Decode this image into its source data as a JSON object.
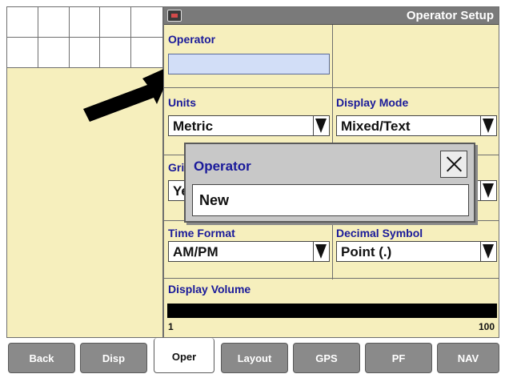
{
  "window": {
    "title": "Operator Setup",
    "icon": "screen-icon"
  },
  "operator": {
    "label": "Operator",
    "value": ""
  },
  "units": {
    "label": "Units",
    "value": "Metric"
  },
  "display_mode": {
    "label": "Display Mode",
    "value": "Mixed/Text"
  },
  "grid_section": {
    "label_fragment": "Gri",
    "value_fragment": "Ye"
  },
  "time_format": {
    "label": "Time Format",
    "value": "AM/PM"
  },
  "decimal_symbol": {
    "label": "Decimal Symbol",
    "value": "Point (.)"
  },
  "display_volume": {
    "label": "Display Volume",
    "min_label": "1",
    "max_label": "100",
    "level_fraction": 1.0
  },
  "popup": {
    "title": "Operator",
    "field_value": "New",
    "close_icon": "close-icon"
  },
  "tabs": [
    {
      "label": "Back",
      "active": false
    },
    {
      "label": "Disp",
      "active": false
    },
    {
      "label": "Oper",
      "active": true
    },
    {
      "label": "Layout",
      "active": false
    },
    {
      "label": "GPS",
      "active": false
    },
    {
      "label": "PF",
      "active": false
    },
    {
      "label": "NAV",
      "active": false
    }
  ],
  "colors": {
    "panel_bg": "#f6efbd",
    "label_text": "#1a1a9a",
    "title_bar": "#7a7a7a",
    "input_highlight": "#d2def7",
    "tab_bg": "#8a8a8a"
  }
}
